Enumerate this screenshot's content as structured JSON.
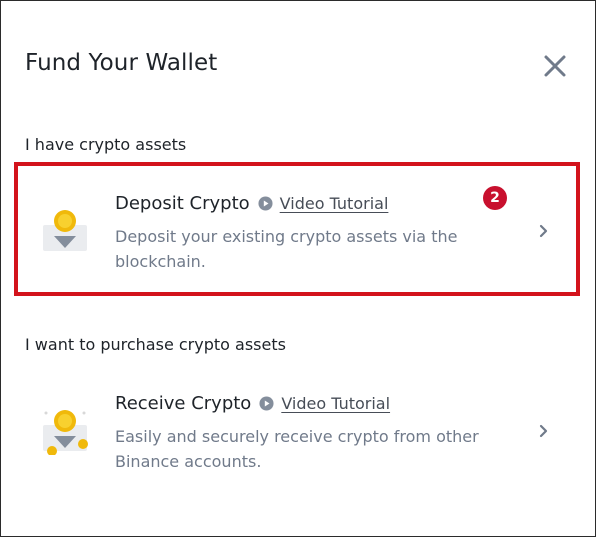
{
  "header": {
    "title": "Fund Your Wallet",
    "close_icon": "close-icon"
  },
  "sections": [
    {
      "label": "I have crypto assets",
      "card": {
        "name": "Deposit Crypto",
        "video_link": "Video Tutorial",
        "description": "Deposit your existing crypto assets via the blockchain.",
        "icon": "deposit-illustration-icon"
      }
    },
    {
      "label": "I want to purchase crypto assets",
      "card": {
        "name": "Receive Crypto",
        "video_link": "Video Tutorial",
        "description": "Easily and securely receive crypto from other Binance accounts.",
        "icon": "receive-illustration-icon"
      }
    }
  ],
  "annotation": {
    "step_number": "2",
    "color": "#d3131c"
  },
  "colors": {
    "coin_yellow": "#f0b90b",
    "text_primary": "#1e2329",
    "text_secondary": "#707a8a"
  }
}
